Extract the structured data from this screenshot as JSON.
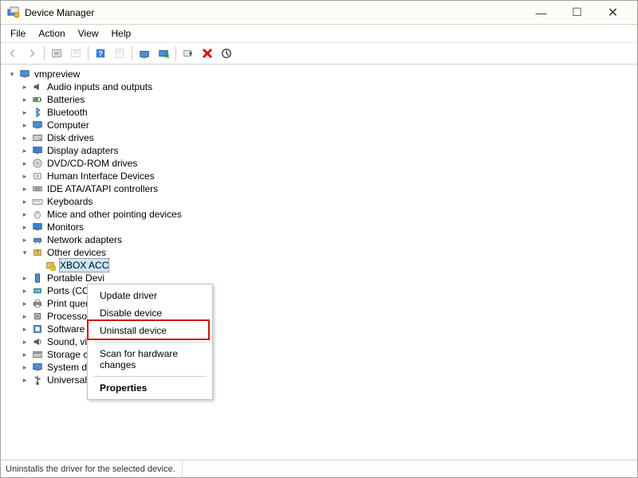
{
  "window": {
    "title": "Device Manager"
  },
  "winbtns": {
    "min": "—",
    "max": "☐",
    "close": "✕"
  },
  "menu": {
    "items": [
      "File",
      "Action",
      "View",
      "Help"
    ]
  },
  "tree": {
    "root": "vmpreview",
    "items": [
      {
        "label": "Audio inputs and outputs",
        "icon": "audio"
      },
      {
        "label": "Batteries",
        "icon": "battery"
      },
      {
        "label": "Bluetooth",
        "icon": "bluetooth"
      },
      {
        "label": "Computer",
        "icon": "computer"
      },
      {
        "label": "Disk drives",
        "icon": "disk"
      },
      {
        "label": "Display adapters",
        "icon": "display"
      },
      {
        "label": "DVD/CD-ROM drives",
        "icon": "dvd"
      },
      {
        "label": "Human Interface Devices",
        "icon": "hid"
      },
      {
        "label": "IDE ATA/ATAPI controllers",
        "icon": "ide"
      },
      {
        "label": "Keyboards",
        "icon": "keyboard"
      },
      {
        "label": "Mice and other pointing devices",
        "icon": "mouse"
      },
      {
        "label": "Monitors",
        "icon": "monitor"
      },
      {
        "label": "Network adapters",
        "icon": "network"
      },
      {
        "label": "Other devices",
        "icon": "other",
        "expanded": true
      },
      {
        "label": "XBOX ACC",
        "icon": "unknown",
        "child": true,
        "selected": true,
        "truncated": true
      },
      {
        "label": "Portable Devi",
        "icon": "portable"
      },
      {
        "label": "Ports (COM &",
        "icon": "port"
      },
      {
        "label": "Print queues",
        "icon": "printer"
      },
      {
        "label": "Processors",
        "icon": "cpu"
      },
      {
        "label": "Software devi",
        "icon": "software"
      },
      {
        "label": "Sound, video",
        "icon": "sound"
      },
      {
        "label": "Storage contr",
        "icon": "storage"
      },
      {
        "label": "System devices",
        "icon": "system"
      },
      {
        "label": "Universal Serial Bus controllers",
        "icon": "usb"
      }
    ]
  },
  "contextmenu": {
    "items": [
      {
        "label": "Update driver"
      },
      {
        "label": "Disable device"
      },
      {
        "label": "Uninstall device",
        "highlighted": true
      },
      {
        "sep": true
      },
      {
        "label": "Scan for hardware changes"
      },
      {
        "sep": true
      },
      {
        "label": "Properties",
        "bold": true
      }
    ]
  },
  "statusbar": {
    "text": "Uninstalls the driver for the selected device."
  }
}
